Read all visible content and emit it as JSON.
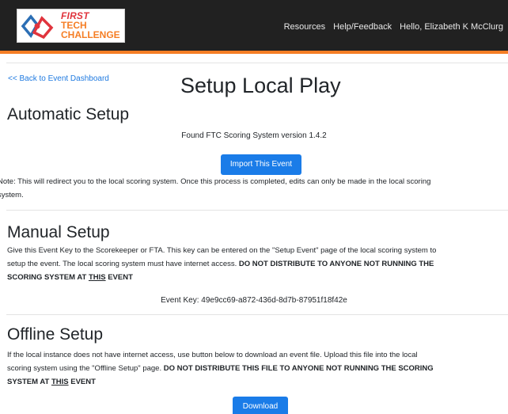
{
  "header": {
    "logo": {
      "line1": "FIRST",
      "line2": "TECH",
      "line3": "CHALLENGE"
    },
    "nav": {
      "resources": "Resources",
      "help": "Help/Feedback",
      "user_greeting": "Hello, Elizabeth K McClurg"
    }
  },
  "page": {
    "back_link": "<< Back to Event Dashboard",
    "title": "Setup Local Play"
  },
  "automatic": {
    "title": "Automatic Setup",
    "found_text": "Found FTC Scoring System version 1.4.2",
    "import_button": "Import This Event",
    "note_line1": "Note: This will redirect you to the local scoring system. Once this process is completed, edits can only be made in the local scoring",
    "note_line2": "system."
  },
  "manual": {
    "title": "Manual Setup",
    "desc_line1": "Give this Event Key to the Scorekeeper or FTA. This key can be entered on the \"Setup Event\" page of the local scoring system to",
    "desc_line2_plain": "setup the event. The local scoring system must have internet access. ",
    "desc_line2_bold": "DO NOT DISTRIBUTE TO ANYONE NOT RUNNING THE",
    "desc_line3_bold_a": "SCORING SYSTEM AT ",
    "desc_line3_bold_u": "THIS",
    "desc_line3_bold_b": " EVENT",
    "event_key": "Event Key: 49e9cc69-a872-436d-8d7b-87951f18f42e"
  },
  "offline": {
    "title": "Offline Setup",
    "desc_line1": "If the local instance does not have internet access, use button below to download an event file. Upload this file into the local",
    "desc_line2_plain": "scoring system using the \"Offline Setup\" page. ",
    "desc_line2_bold": "DO NOT DISTRIBUTE THIS FILE TO ANYONE NOT RUNNING THE SCORING",
    "desc_line3_bold_a": "SYSTEM AT ",
    "desc_line3_bold_u": "THIS",
    "desc_line3_bold_b": " EVENT",
    "download_button": "Download"
  },
  "colors": {
    "navbar": "#212121",
    "accent_orange": "#f57e25",
    "link_blue": "#1f7ae0",
    "button_blue": "#1a7ce8"
  }
}
